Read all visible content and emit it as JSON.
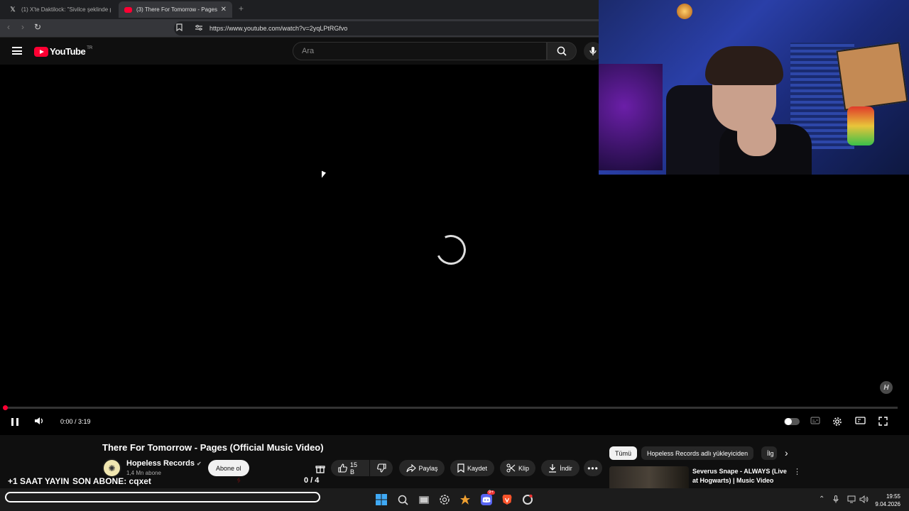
{
  "browser": {
    "tabs": [
      {
        "label": "(1) X'te Daktilock: \"Sivilce şeklinde p…",
        "favicon": "x-logo-icon"
      },
      {
        "label": "(3) There For Tomorrow - Pages",
        "favicon": "youtube-icon",
        "active": true
      }
    ],
    "url": "https://www.youtube.com/watch?v=2yqLPtRGfvo"
  },
  "youtube": {
    "logo_text": "YouTube",
    "country_code": "TR",
    "search_placeholder": "Ara"
  },
  "player": {
    "state": "loading",
    "time": "0:00 / 3:19",
    "progress": 0,
    "watermark": "H"
  },
  "video": {
    "title": "There For Tomorrow - Pages (Official Music Video)",
    "channel": "Hopeless Records",
    "verified": true,
    "subscribers": "1,4 Mn abone",
    "subscribe_label": "Abone ol",
    "like_count": "15 B",
    "share_label": "Paylaş",
    "save_label": "Kaydet",
    "clip_label": "Klip",
    "download_label": "İndir"
  },
  "related": {
    "chips": [
      "Tümü",
      "Hopeless Records adlı yükleyiciden",
      "İlg"
    ],
    "items": [
      {
        "title": "Severus Snape - ALWAYS (Live at Hogwarts) | Music Video"
      }
    ]
  },
  "stream_overlay": {
    "left_text": "+1 SAAT YAYIN",
    "sub_text": "SON ABONE: cqxet",
    "counter": "0 / 4"
  },
  "taskbar": {
    "time": "19:55",
    "date": "9.04.2026",
    "discord_badge": "9+"
  }
}
